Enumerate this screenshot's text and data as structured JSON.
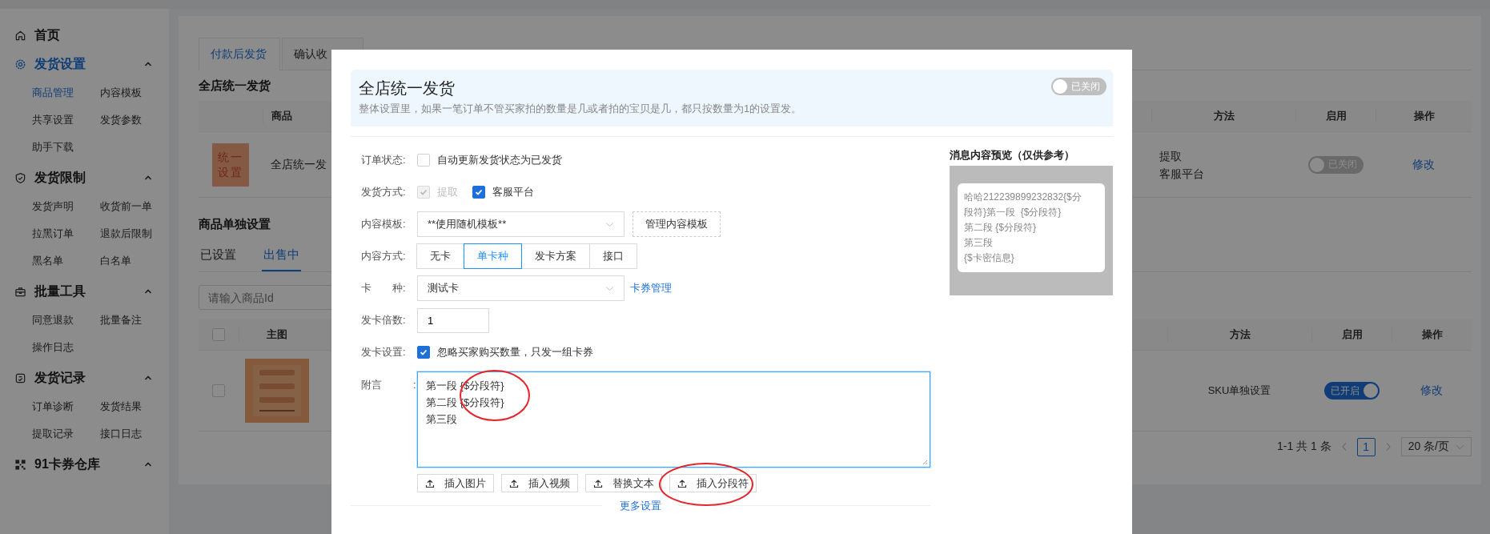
{
  "sidebar": {
    "sections": [
      {
        "label": "首页",
        "kind": "home",
        "selected": false
      },
      {
        "label": "发货设置",
        "kind": "gear",
        "selected": true,
        "expanded": true,
        "children": [
          {
            "label": "商品管理",
            "selected": true
          },
          {
            "label": "内容模板",
            "selected": false
          },
          {
            "label": "共享设置",
            "selected": false
          },
          {
            "label": "发货参数",
            "selected": false
          },
          {
            "label": "助手下载",
            "selected": false
          }
        ]
      },
      {
        "label": "发货限制",
        "kind": "shield",
        "selected": false,
        "expanded": true,
        "children": [
          {
            "label": "发货声明",
            "selected": false
          },
          {
            "label": "收货前一单",
            "selected": false
          },
          {
            "label": "拉黑订单",
            "selected": false
          },
          {
            "label": "退款后限制",
            "selected": false
          },
          {
            "label": "黑名单",
            "selected": false
          },
          {
            "label": "白名单",
            "selected": false
          }
        ]
      },
      {
        "label": "批量工具",
        "kind": "toolbox",
        "selected": false,
        "expanded": true,
        "children": [
          {
            "label": "同意退款",
            "selected": false
          },
          {
            "label": "批量备注",
            "selected": false
          },
          {
            "label": "操作日志",
            "selected": false
          }
        ]
      },
      {
        "label": "发货记录",
        "kind": "clipboard",
        "selected": false,
        "expanded": true,
        "children": [
          {
            "label": "订单诊断",
            "selected": false
          },
          {
            "label": "发货结果",
            "selected": false
          },
          {
            "label": "提取记录",
            "selected": false
          },
          {
            "label": "接口日志",
            "selected": false
          }
        ]
      },
      {
        "label": "91卡券仓库",
        "kind": "grid",
        "selected": false,
        "expanded": true
      }
    ]
  },
  "tabs": [
    {
      "label": "付款后发货",
      "selected": true
    },
    {
      "label": "确认收",
      "selected": false
    }
  ],
  "store_wide": {
    "heading": "全店统一发货",
    "columns": [
      "商品",
      "方法",
      "启用",
      "操作"
    ],
    "rows": [
      {
        "thumb": "统一设置",
        "product": "全店统一发",
        "methods": [
          "提取",
          "客服平台"
        ],
        "enabled": false,
        "toggle_label": "已关闭",
        "action": "修改"
      }
    ]
  },
  "single": {
    "heading": "商品单独设置",
    "tabs": [
      {
        "label": "已设置",
        "selected": false
      },
      {
        "label": "出售中",
        "selected": true
      }
    ],
    "search": {
      "placeholder": "请输入商品Id"
    },
    "header_checked": false,
    "columns": [
      "主图",
      "方法",
      "启用",
      "操作"
    ],
    "rows": [
      {
        "checked": false,
        "method": "SKU单独设置",
        "enabled": true,
        "toggle_label": "已开启",
        "action": "修改"
      }
    ],
    "pagination": {
      "summary": "1-1 共 1 条",
      "pages": [
        {
          "label": "1",
          "selected": true
        }
      ],
      "page_size": "20 条/页"
    }
  },
  "dialog": {
    "banner": {
      "title": "全店统一发货",
      "description": "整体设置里，如果一笔订单不管买家拍的数量是几或者拍的宝贝是几，都只按数量为1的设置发。",
      "enabled": false,
      "toggle_label": "已关闭"
    },
    "form": [
      {
        "kind": "checkbox",
        "label": "订单状态:",
        "options": [
          {
            "label": "自动更新发货状态为已发货",
            "checked": false,
            "disabled": false
          }
        ]
      },
      {
        "kind": "checkbox",
        "label": "发货方式:",
        "options": [
          {
            "label": "提取",
            "checked": true,
            "disabled": true
          },
          {
            "label": "客服平台",
            "checked": true,
            "disabled": false
          }
        ]
      },
      {
        "kind": "select",
        "label": "内容模板:",
        "value": "**使用随机模板**",
        "button": "管理内容模板"
      },
      {
        "kind": "segmented",
        "label": "内容方式:",
        "options": [
          {
            "label": "无卡",
            "selected": false
          },
          {
            "label": "单卡种",
            "selected": true
          },
          {
            "label": "发卡方案",
            "selected": false
          },
          {
            "label": "接口",
            "selected": false
          }
        ]
      },
      {
        "kind": "select",
        "label": "卡　　种:",
        "value": "测试卡",
        "link": "卡券管理"
      },
      {
        "kind": "input",
        "label": "发卡倍数:",
        "value": "1"
      },
      {
        "kind": "checkbox",
        "label": "发卡设置:",
        "options": [
          {
            "label": "忽略买家购买数量，只发一组卡券",
            "checked": true,
            "disabled": false
          }
        ]
      },
      {
        "kind": "textarea",
        "label": "附言　　　:",
        "value": "第一段 {$分段符}\n第二段 {$分段符}\n第三段",
        "buttons": [
          "插入图片",
          "插入视频",
          "替换文本",
          "插入分段符"
        ]
      }
    ],
    "more_link": "更多设置",
    "preview": {
      "title": "消息内容预览（仅供参考）",
      "lines": [
        "哈哈212239899232832{$分",
        "段符}第一段  {$分段符}",
        "第二段 {$分段符}",
        "第三段",
        "{$卡密信息}"
      ]
    }
  }
}
